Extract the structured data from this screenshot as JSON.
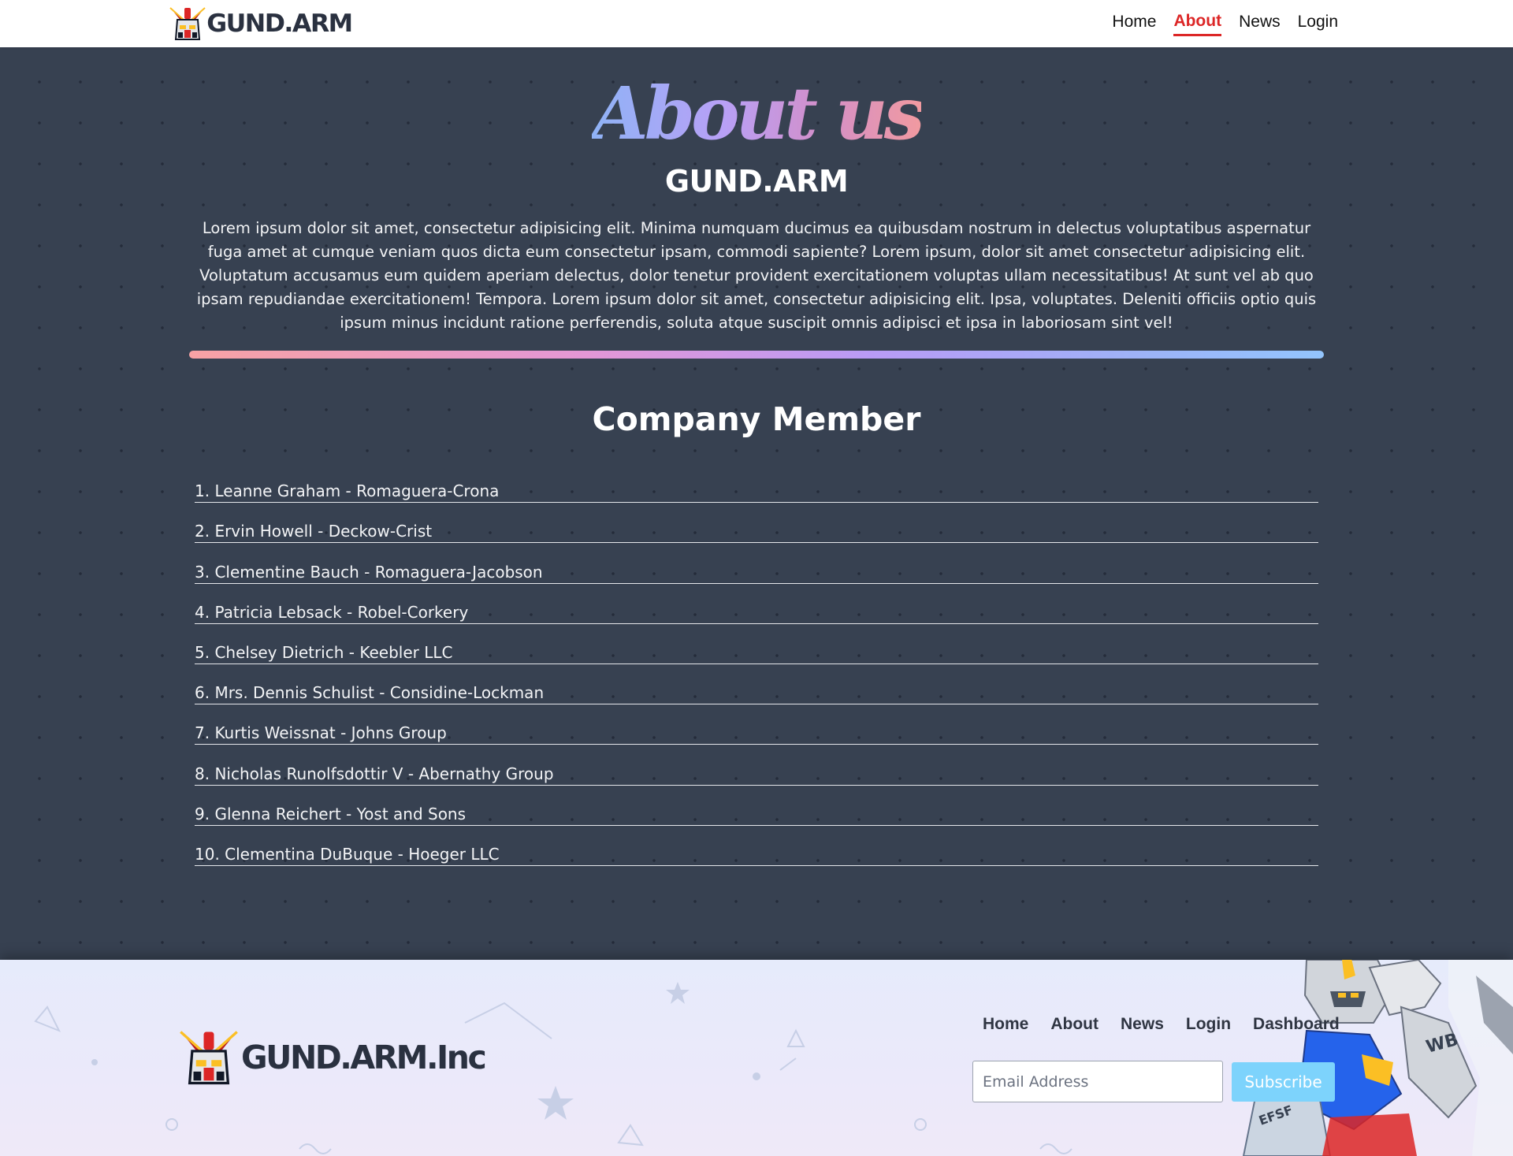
{
  "header": {
    "brand": "GUND.ARM",
    "nav": [
      {
        "label": "Home",
        "active": false
      },
      {
        "label": "About",
        "active": true
      },
      {
        "label": "News",
        "active": false
      },
      {
        "label": "Login",
        "active": false
      }
    ]
  },
  "main": {
    "title": "About us",
    "subtitle": "GUND.ARM",
    "intro": "Lorem ipsum dolor sit amet, consectetur adipisicing elit. Minima numquam ducimus ea quibusdam nostrum in delectus voluptatibus aspernatur fuga amet at cumque veniam quos dicta eum consectetur ipsam, commodi sapiente? Lorem ipsum, dolor sit amet consectetur adipisicing elit. Voluptatum accusamus eum quidem aperiam delectus, dolor tenetur provident exercitationem voluptas ullam necessitatibus! At sunt vel ab quo ipsam repudiandae exercitationem! Tempora. Lorem ipsum dolor sit amet, consectetur adipisicing elit. Ipsa, voluptates. Deleniti officiis optio quis ipsum minus incidunt ratione perferendis, soluta atque suscipit omnis adipisci et ipsa in laboriosam sint vel!",
    "members_title": "Company Member",
    "members": [
      "1. Leanne Graham - Romaguera-Crona",
      "2. Ervin Howell - Deckow-Crist",
      "3. Clementine Bauch - Romaguera-Jacobson",
      "4. Patricia Lebsack - Robel-Corkery",
      "5. Chelsey Dietrich - Keebler LLC",
      "6. Mrs. Dennis Schulist - Considine-Lockman",
      "7. Kurtis Weissnat - Johns Group",
      "8. Nicholas Runolfsdottir V - Abernathy Group",
      "9. Glenna Reichert - Yost and Sons",
      "10. Clementina DuBuque - Hoeger LLC"
    ]
  },
  "footer": {
    "brand": "GUND.ARM.Inc",
    "nav": [
      "Home",
      "About",
      "News",
      "Login",
      "Dashboard"
    ],
    "email_placeholder": "Email Address",
    "subscribe_label": "Subscribe",
    "robot_markings": [
      "WB",
      "EFSF"
    ]
  },
  "colors": {
    "active_nav": "#dc2626",
    "main_bg": "#374151",
    "subscribe_bg": "#7dd3fc"
  }
}
